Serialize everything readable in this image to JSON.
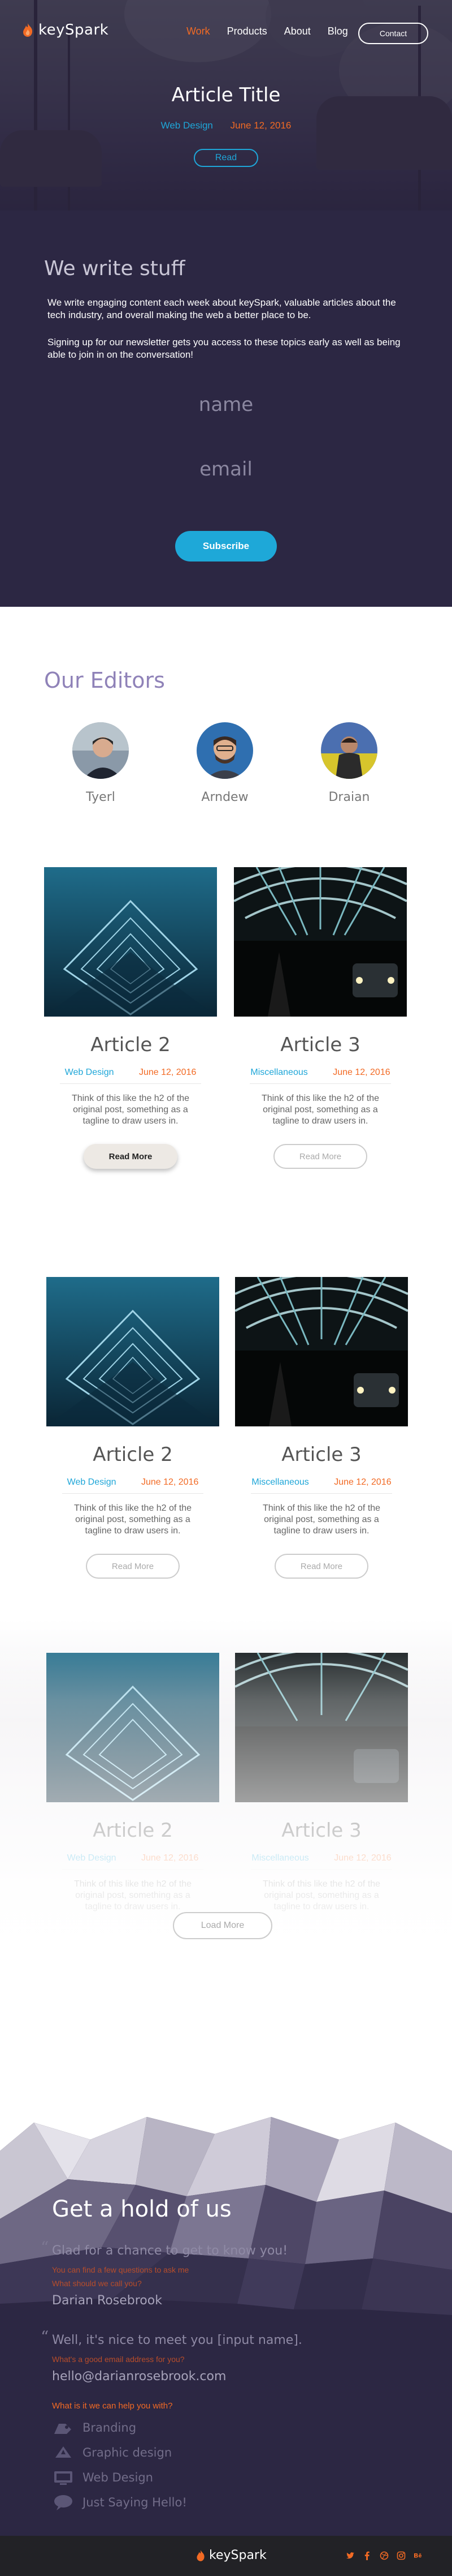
{
  "brand": {
    "name": "keySpark"
  },
  "nav": {
    "items": [
      {
        "label": "Work",
        "active": true
      },
      {
        "label": "Products",
        "active": false
      },
      {
        "label": "About",
        "active": false
      },
      {
        "label": "Blog",
        "active": false
      }
    ],
    "contact_label": "Contact"
  },
  "hero": {
    "title": "Article Title",
    "category": "Web Design",
    "date": "June 12, 2016",
    "read_label": "Read"
  },
  "newsletter": {
    "heading": "We write stuff",
    "para1": "We write engaging content each week about keySpark, valuable articles about the tech industry, and overall making the web a better place to be.",
    "para2": "Signing up for our newsletter gets you access to these topics early as well as being able to join in on the conversation!",
    "name_placeholder": "name",
    "email_placeholder": "email",
    "subscribe_label": "Subscribe"
  },
  "editors": {
    "heading": "Our Editors",
    "people": [
      {
        "name": "Tyerl"
      },
      {
        "name": "Arndew"
      },
      {
        "name": "Draian"
      }
    ]
  },
  "articles": {
    "row1": [
      {
        "title": "Article 2",
        "category": "Web Design",
        "date": "June 12, 2016",
        "desc": "Think of this like the h2 of the original post, something as a tagline to draw users in.",
        "button": "Read More"
      },
      {
        "title": "Article 3",
        "category": "Miscellaneous",
        "date": "June 12, 2016",
        "desc": "Think of this like the h2 of the original post, something as a tagline to draw users in.",
        "button": "Read More"
      }
    ],
    "row2": [
      {
        "title": "Article 2",
        "category": "Web Design",
        "date": "June 12, 2016",
        "desc": "Think of this like the h2 of the original post, something as a tagline to draw users in.",
        "button": "Read More"
      },
      {
        "title": "Article 3",
        "category": "Miscellaneous",
        "date": "June 12, 2016",
        "desc": "Think of this like the h2 of the original post, something as a tagline to draw users in.",
        "button": "Read More"
      }
    ],
    "row3": [
      {
        "title": "Article 2",
        "category": "Web Design",
        "date": "June 12, 2016",
        "desc": "Think of this like the h2 of the original post, something as a tagline to draw users in."
      },
      {
        "title": "Article 3",
        "category": "Miscellaneous",
        "date": "June 12, 2016",
        "desc": "Think of this like the h2 of the original post, something as a tagline to draw users in."
      }
    ],
    "load_more_label": "Load More"
  },
  "contact": {
    "heading": "Get a hold of us",
    "q1": "Glad for a chance to get to know you!",
    "q1_sub1": "You can find a few questions to ask me",
    "q1_sub2": "What should we call you?",
    "a1": "Darian Rosebrook",
    "q2": "Well, it's nice to meet you [input name].",
    "q2_sub": "What's a good email address for you?",
    "a2": "hello@darianrosebrook.com",
    "q3": "What is it we can help you with?",
    "options": [
      "Branding",
      "Graphic design",
      "Web Design",
      "Just Saying Hello!"
    ]
  },
  "footer": {
    "brand": "keySpark",
    "socials": [
      "twitter-icon",
      "facebook-icon",
      "dribbble-icon",
      "instagram-icon",
      "behance-icon"
    ]
  },
  "colors": {
    "accent_orange": "#f26a24",
    "accent_blue": "#1ea6d8",
    "navy": "#2c2743"
  }
}
